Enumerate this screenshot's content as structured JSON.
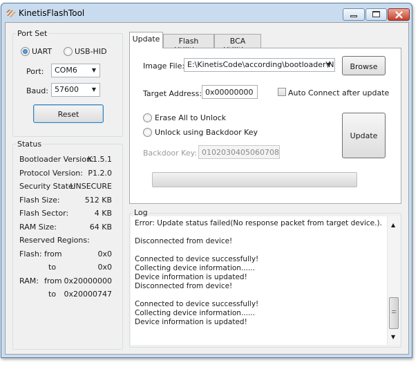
{
  "window": {
    "title": "KinetisFlashTool"
  },
  "port_set": {
    "title": "Port Set",
    "uart_label": "UART",
    "usb_label": "USB-HID",
    "port_label": "Port:",
    "port_value": "COM6",
    "baud_label": "Baud:",
    "baud_value": "57600",
    "reset_label": "Reset"
  },
  "status": {
    "title": "Status",
    "bootloader_label": "Bootloader Version:",
    "bootloader_value": "K1.5.1",
    "protocol_label": "Protocol Version:",
    "protocol_value": "P1.2.0",
    "security_label": "Security State:",
    "security_value": "UNSECURE",
    "flash_size_label": "Flash Size:",
    "flash_size_value": "512 KB",
    "flash_sector_label": "Flash Sector:",
    "flash_sector_value": "4 KB",
    "ram_size_label": "RAM Size:",
    "ram_size_value": "64 KB",
    "reserved_label": "Reserved Regions:",
    "flash_label": "Flash:",
    "from_label": "from",
    "to_label": "to",
    "flash_from": "0x0",
    "flash_to": "0x0",
    "ram_label": "RAM:",
    "ram_from": "0x20000000",
    "ram_to": "0x20000747"
  },
  "tabs": [
    {
      "label": "Update"
    },
    {
      "label": "Flash Utilities"
    },
    {
      "label": "BCA Utilities"
    }
  ],
  "update": {
    "image_file_label": "Image File:",
    "image_file_value": "E:\\KinetisCode\\according\\bootloader\\NXP",
    "browse_label": "Browse",
    "target_address_label": "Target Address:",
    "target_address_value": "0x00000000",
    "auto_connect_label": "Auto Connect after update",
    "erase_all_label": "Erase All to Unlock",
    "unlock_backdoor_label": "Unlock using Backdoor Key",
    "backdoor_key_label": "Backdoor Key:",
    "backdoor_key_value": "0102030405060708",
    "update_label": "Update",
    "progress": 0
  },
  "log": {
    "title": "Log",
    "lines": [
      "Error: Update status failed(No response packet from target device.).",
      "",
      "Disconnected from device!",
      "",
      "Connected to device successfully!",
      "Collecting device information......",
      "Device information is updated!",
      "Disconnected from device!",
      "",
      "Connected to device successfully!",
      "Collecting device information......",
      "Device information is updated!"
    ]
  },
  "colors": {
    "window_frame": "#c9dcef",
    "client_bg": "#f0f0f0",
    "close_button": "#c7402a"
  }
}
